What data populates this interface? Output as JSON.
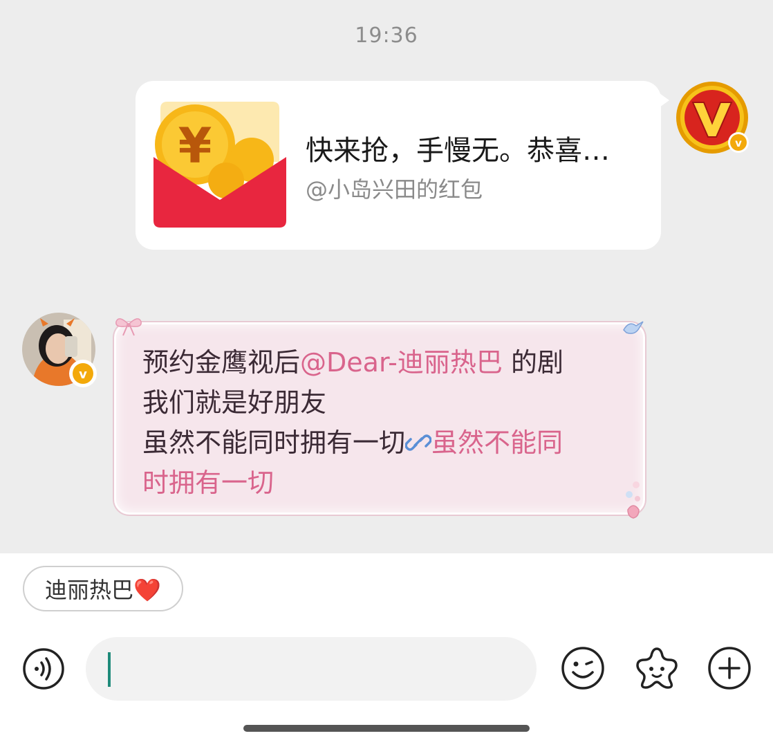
{
  "chat": {
    "timestamp": "19:36",
    "red_packet": {
      "title": "快来抢，手慢无。恭喜…",
      "subtitle": "@小岛兴田的红包",
      "accent": "#e8263f"
    },
    "friend_message": {
      "line1_prefix": "预约金鹰视后",
      "line1_mention": "@Dear-迪丽热巴",
      "line1_suffix": " 的剧",
      "line2": "我们就是好朋友",
      "line3_prefix": "虽然不能同时拥有一切",
      "line3_link": "虽然不能同",
      "line4_link": "时拥有一切",
      "link_color": "#d9648c"
    }
  },
  "suggestion": {
    "label": "迪丽热巴❤️"
  },
  "composer": {
    "voice_icon": "voice-icon",
    "emoji_icon": "emoji-icon",
    "sticker_icon": "sticker-icon",
    "plus_icon": "plus-icon"
  }
}
